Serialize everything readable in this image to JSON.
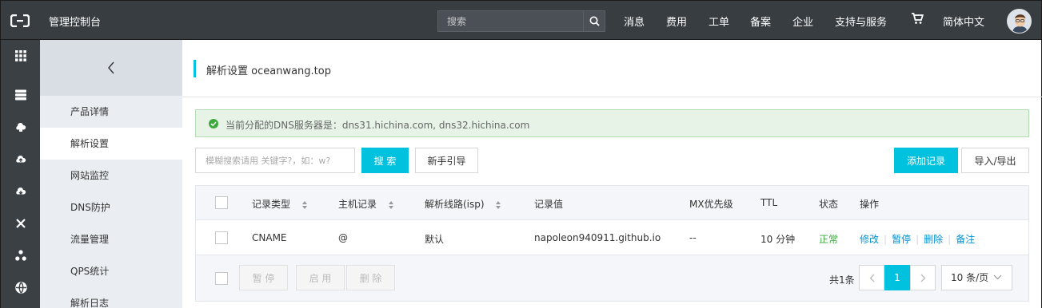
{
  "topbar": {
    "title": "管理控制台",
    "search_placeholder": "搜索",
    "nav": [
      "消息",
      "费用",
      "工单",
      "备案",
      "企业",
      "支持与服务"
    ],
    "language": "简体中文"
  },
  "rail": {
    "icons": [
      "grid-icon",
      "server-icon",
      "cloud-shield-icon",
      "cloud-upload-icon",
      "cloud-download-icon",
      "network-icon",
      "cluster-icon",
      "globe-icon"
    ]
  },
  "subnav": {
    "items": [
      "产品详情",
      "解析设置",
      "网站监控",
      "DNS防护",
      "流量管理",
      "QPS统计",
      "解析日志"
    ],
    "active_index": 1
  },
  "page": {
    "title": "解析设置 oceanwang.top",
    "alert": "当前分配的DNS服务器是：dns31.hichina.com, dns32.hichina.com",
    "filter_placeholder": "模糊搜索请用 关键字?，如：w?",
    "search_button": "搜 索",
    "guide_button": "新手引导",
    "add_button": "添加记录",
    "import_button": "导入/导出"
  },
  "table": {
    "headers": {
      "type": "记录类型",
      "host": "主机记录",
      "line": "解析线路(isp)",
      "value": "记录值",
      "mx": "MX优先级",
      "ttl": "TTL",
      "status": "状态",
      "actions": "操作"
    },
    "rows": [
      {
        "type": "CNAME",
        "host": "@",
        "line": "默认",
        "value": "napoleon940911.github.io",
        "mx": "--",
        "ttl": "10 分钟",
        "status": "正常",
        "actions": [
          "修改",
          "暂停",
          "删除",
          "备注"
        ]
      }
    ],
    "footer": {
      "pause": "暂 停",
      "enable": "启 用",
      "delete": "删 除",
      "total": "共1条",
      "current_page": "1",
      "page_size": "10 条/页"
    }
  },
  "colors": {
    "accent": "#00c1de",
    "topbar": "#373d41",
    "success": "#3ba93b",
    "link": "#0090cf"
  }
}
